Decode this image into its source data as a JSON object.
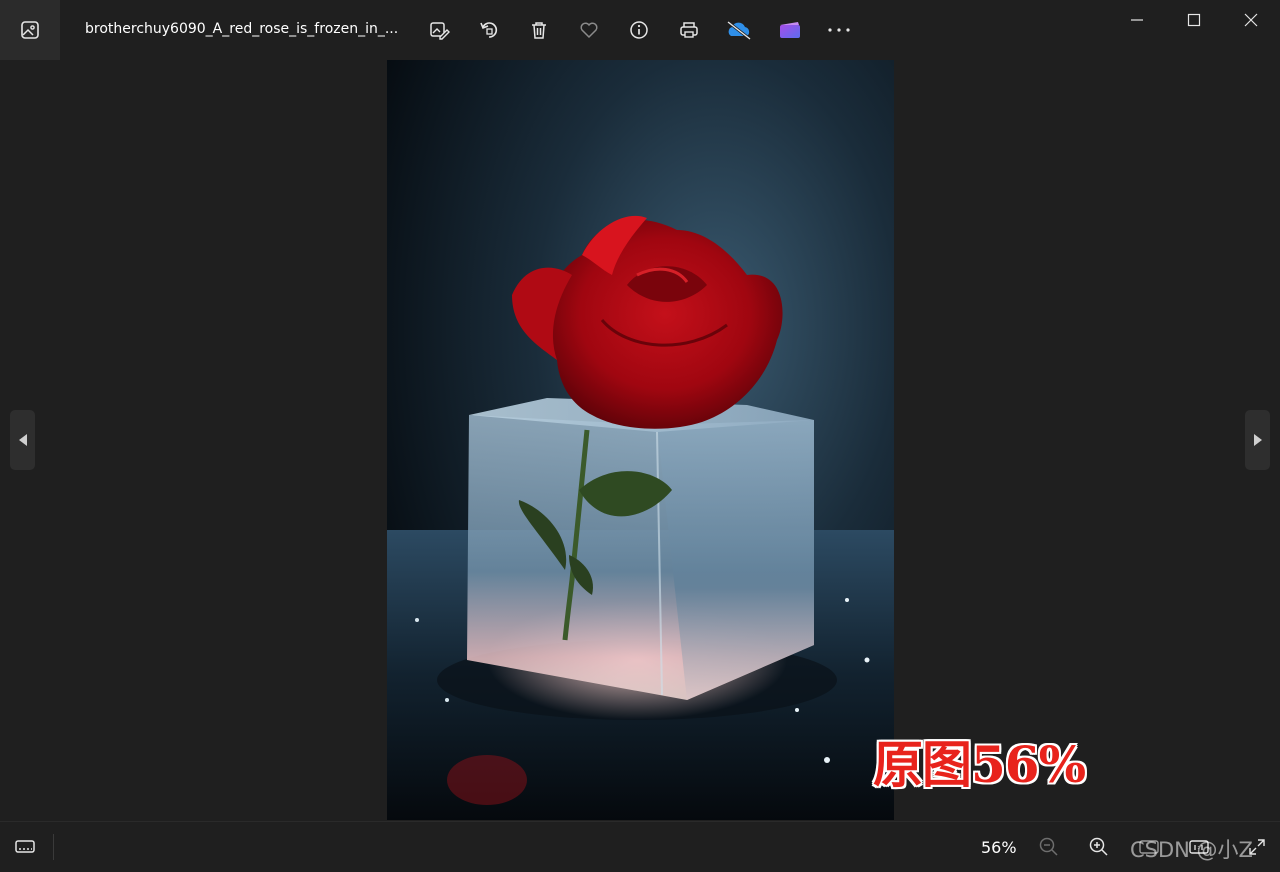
{
  "window": {
    "title": "brotherchuy6090_A_red_rose_is_frozen_in_..."
  },
  "toolbar": {
    "icons": [
      "edit-image-icon",
      "rotate-icon",
      "delete-icon",
      "favorite-heart-icon",
      "info-icon",
      "print-icon",
      "onedrive-icon",
      "clipchamp-icon",
      "more-icon"
    ]
  },
  "status": {
    "zoom": "56%"
  },
  "overlay": {
    "label": "原图56%"
  },
  "watermark": {
    "text": "CSDN @小Z"
  },
  "colors": {
    "background": "#1f1f1f",
    "overlay_text": "#e8231c"
  }
}
